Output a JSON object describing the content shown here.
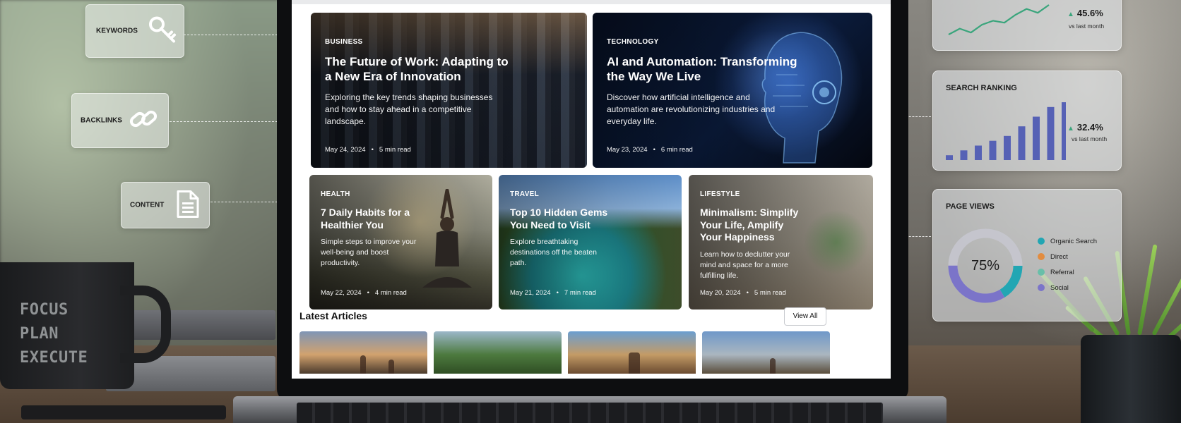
{
  "screen": {
    "featured": [
      {
        "category": "BUSINESS",
        "title": "The Future of Work: Adapting to a New Era of Innovation",
        "description": "Exploring the key trends shaping businesses and how to stay ahead in a competitive landscape.",
        "date": "May 24, 2024",
        "read_time": "5 min read"
      },
      {
        "category": "TECHNOLOGY",
        "title": "AI and Automation: Transforming the Way We Live",
        "description": "Discover how artificial intelligence and automation are revolutionizing industries and everyday life.",
        "date": "May 23, 2024",
        "read_time": "6 min read"
      }
    ],
    "secondary": [
      {
        "category": "HEALTH",
        "title": "7 Daily Habits for a Healthier You",
        "description": "Simple steps to improve your well-being and boost productivity.",
        "date": "May 22, 2024",
        "read_time": "4 min read"
      },
      {
        "category": "TRAVEL",
        "title": "Top 10 Hidden Gems You Need to Visit",
        "description": "Explore breathtaking destinations off the beaten path.",
        "date": "May 21, 2024",
        "read_time": "7 min read"
      },
      {
        "category": "LIFESTYLE",
        "title": "Minimalism: Simplify Your Life, Amplify Your Happiness",
        "description": "Learn how to declutter your mind and space for a more fulfilling life.",
        "date": "May 20, 2024",
        "read_time": "5 min read"
      }
    ],
    "latest": {
      "title": "Latest Articles",
      "view_all_label": "View All"
    },
    "meta_separator": "•"
  },
  "seo_tags": {
    "keywords": "KEYWORDS",
    "backlinks": "BACKLINKS",
    "content": "CONTENT"
  },
  "analytics": {
    "traffic": {
      "change": "45.6%",
      "change_sub": "vs last month",
      "trend": [
        3,
        6,
        4,
        8,
        10,
        9,
        13,
        16,
        14,
        18
      ]
    },
    "search_ranking": {
      "title": "SEARCH RANKING",
      "change": "32.4%",
      "change_sub": "vs last month",
      "bars": [
        1,
        2,
        3,
        4,
        5,
        7,
        9,
        11,
        12
      ]
    },
    "page_views": {
      "title": "PAGE VIEWS",
      "center_value": "75%",
      "value_fraction": 0.75,
      "legend": [
        {
          "label": "Organic Search",
          "color": "#22a6b3"
        },
        {
          "label": "Direct",
          "color": "#e28c3f"
        },
        {
          "label": "Referral",
          "color": "#68bfa9"
        },
        {
          "label": "Social",
          "color": "#7b74c9"
        }
      ]
    },
    "up_color": "#3aa57c",
    "bar_color": "#5661b5"
  },
  "mug": {
    "lines": [
      "FOCUS",
      "PLAN",
      "EXECUTE"
    ]
  }
}
